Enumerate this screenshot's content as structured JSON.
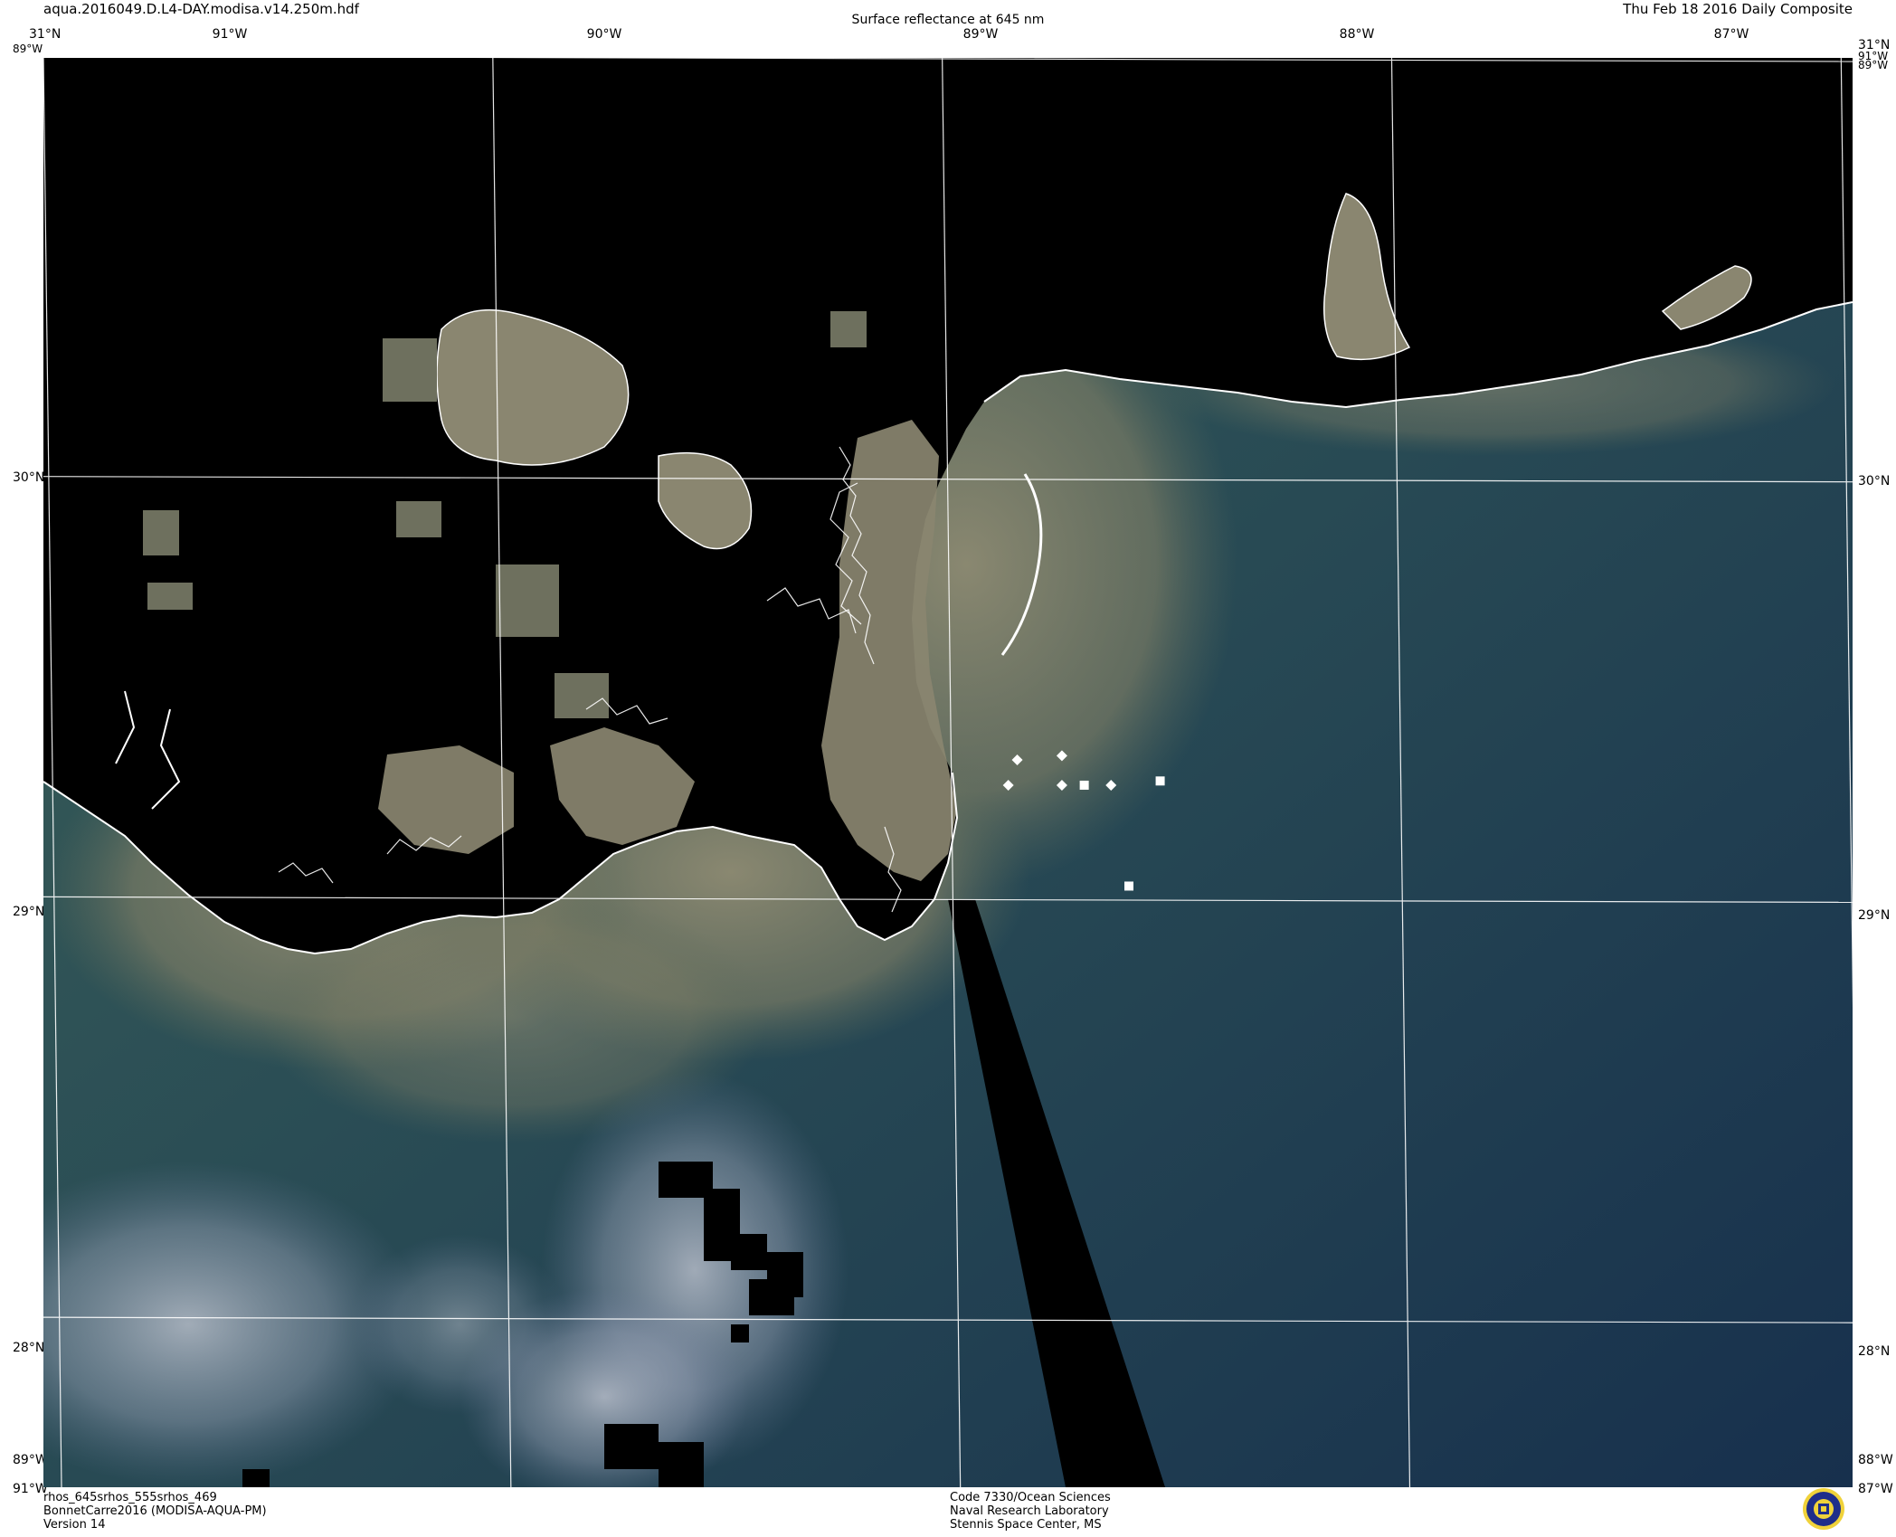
{
  "header": {
    "file_name": "aqua.2016049.D.L4-DAY.modisa.v14.250m.hdf",
    "product_title": "Surface reflectance at 645 nm",
    "date_label": "Thu Feb 18 2016 Daily Composite"
  },
  "axes": {
    "top_lon_labels": [
      "31°N",
      "91°W",
      "90°W",
      "89°W",
      "88°W",
      "87°W",
      "31°N"
    ],
    "lat_labels": [
      "30°N",
      "29°N",
      "28°N"
    ],
    "corner_labels": {
      "top_left_lat": "31°N",
      "top_left_lon": "89°W",
      "top_right_lat": "31°N",
      "top_right_lon": "91°W",
      "top_right_lon2": "89°W",
      "bottom_left_lat": "89°W",
      "bottom_left_lon": "91°W",
      "bottom_right_lat": "88°W",
      "bottom_right_lon": "87°W"
    }
  },
  "footer": {
    "left": [
      "rhos_645srhos_555srhos_469",
      "BonnetCarre2016 (MODISA-AQUA-PM)",
      "Version 14"
    ],
    "center": [
      "Code 7330/Ocean Sciences",
      "Naval Research Laboratory",
      "Stennis Space Center, MS"
    ]
  },
  "map": {
    "extent": {
      "lon_min": -91.0,
      "lon_max": -86.95,
      "lat_min": 27.6,
      "lat_max": 31.0
    },
    "graticule": {
      "lons": [
        -91,
        -90,
        -89,
        -88,
        -87
      ],
      "lats": [
        31,
        30,
        29,
        28
      ]
    },
    "markers": [
      {
        "shape": "diamond",
        "lon": -88.82,
        "lat": 29.33
      },
      {
        "shape": "diamond",
        "lon": -88.72,
        "lat": 29.34
      },
      {
        "shape": "diamond",
        "lon": -88.84,
        "lat": 29.27
      },
      {
        "shape": "diamond",
        "lon": -88.72,
        "lat": 29.27
      },
      {
        "shape": "square",
        "lon": -88.67,
        "lat": 29.27
      },
      {
        "shape": "diamond",
        "lon": -88.61,
        "lat": 29.27
      },
      {
        "shape": "square",
        "lon": -88.5,
        "lat": 29.28
      },
      {
        "shape": "square",
        "lon": -88.57,
        "lat": 29.03
      }
    ],
    "colors": {
      "background_land": "#000000",
      "sediment_plume": "#8c8a72",
      "shelf_water": "#355a55",
      "open_water": "#1a3350",
      "clouds": "#9a9fb0",
      "coastline": "#ffffff",
      "graticule": "#ffffff"
    }
  }
}
